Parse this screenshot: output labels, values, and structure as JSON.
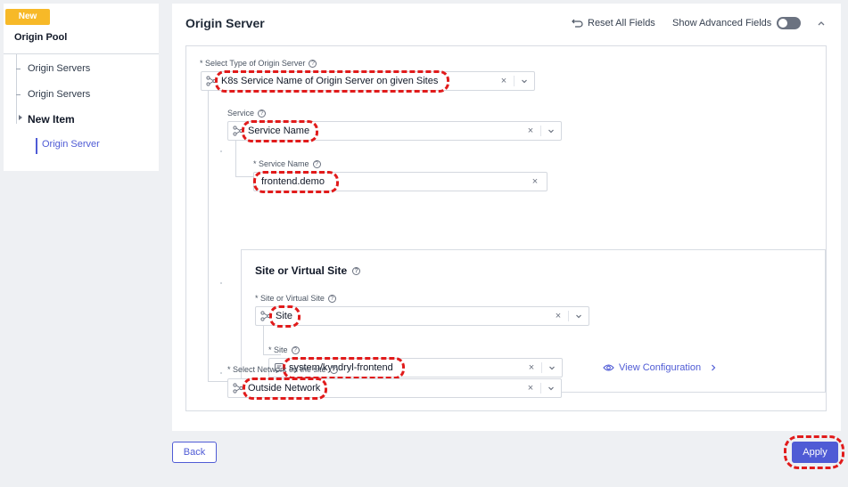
{
  "nav": {
    "badge": "New",
    "title": "Origin Pool",
    "items": [
      "Origin Servers",
      "Origin Servers"
    ],
    "current": "New Item",
    "sub": "Origin Server"
  },
  "header": {
    "title": "Origin Server",
    "reset_label": "Reset All Fields",
    "advanced_label": "Show Advanced Fields",
    "advanced_on": false
  },
  "form": {
    "type_label": "* Select Type of Origin Server",
    "type_value": "K8s Service Name of Origin Server on given Sites",
    "service_label": "Service",
    "service_value": "Service Name",
    "service_name_label": "* Service Name",
    "service_name_value": "frontend.demo",
    "site_section_title": "Site or Virtual Site",
    "site_or_virtual_label": "* Site or Virtual Site",
    "site_or_virtual_value": "Site",
    "site_label": "* Site",
    "site_value": "system/kyndryl-frontend",
    "view_config": "View Configuration",
    "network_label": "* Select Network on the site",
    "network_value": "Outside Network"
  },
  "buttons": {
    "back": "Back",
    "apply": "Apply"
  },
  "colors": {
    "accent": "#4f5bd5",
    "badge": "#f7b928",
    "highlight": "#e11b1b"
  },
  "icons": {
    "help": "?",
    "clear": "×"
  }
}
